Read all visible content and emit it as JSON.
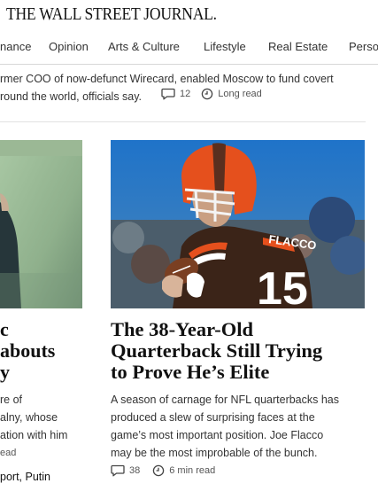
{
  "masthead": {
    "logo": "THE WALL STREET JOURNAL."
  },
  "nav": {
    "items": [
      "nance",
      "Opinion",
      "Arts & Culture",
      "Lifestyle",
      "Real Estate",
      "Perso"
    ]
  },
  "top_story": {
    "summary_lines": [
      "rmer COO of now-defunct Wirecard, enabled Moscow to fund covert",
      "round the world, officials say."
    ],
    "comments": "12",
    "read_time": "Long read"
  },
  "left_card": {
    "headline_lines": [
      "c",
      "abouts",
      "y"
    ],
    "summary_lines": [
      "re of",
      "alny, whose",
      "ation with him",
      "ead"
    ],
    "tags": [
      "port",
      "Putin"
    ],
    "tag_separator": ", "
  },
  "right_card": {
    "image_alt": "Cleveland Browns quarterback wearing orange helmet and number 15 jersey",
    "jersey_name": "FLACCO",
    "jersey_number": "15",
    "headline_lines": [
      "The 38-Year-Old",
      "Quarterback Still Trying",
      "to Prove He’s Elite"
    ],
    "summary_lines": [
      "A season of carnage for NFL quarterbacks has",
      "produced a slew of surprising faces at the",
      "game’s most important position. Joe Flacco",
      "may be the most improbable of the bunch."
    ],
    "comments": "38",
    "read_time": "6 min read"
  },
  "icons": {
    "comment": "comment-bubble-icon",
    "clock": "clock-icon"
  },
  "colors": {
    "browns_orange": "#e5501d",
    "browns_brown": "#3b2418",
    "sky_blue": "#3f7fbf"
  }
}
